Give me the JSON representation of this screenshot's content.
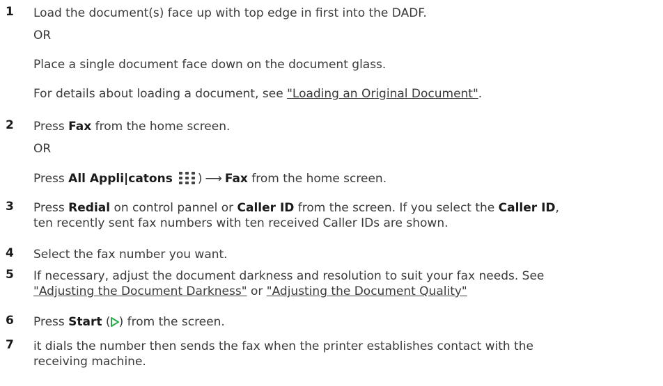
{
  "steps": [
    {
      "number": "1",
      "text": "Load the document(s) face up with top edge in first into the DADF.",
      "or1": "OR",
      "alt": "Place a single document face down on the document glass.",
      "details_prefix": "For details about loading a document, see ",
      "details_link": "\"Loading an Original Document\"",
      "details_suffix": "."
    },
    {
      "number": "2",
      "press": "Press ",
      "fax": "Fax",
      "from_home": " from the home screen.",
      "or": "OR",
      "press2": "Press ",
      "all_apps": "All Appli|catons",
      "close_paren": ")",
      "arrow": "⟶",
      "fax2": "Fax",
      "from_home2": " from the home screen."
    },
    {
      "number": "3",
      "press": "Press ",
      "redial": "Redial",
      "mid": " on control pannel or ",
      "caller_id": "Caller ID",
      "mid2": " from the screen. If you select the ",
      "caller_id2": "Caller ID",
      "end": ",",
      "line2": "ten recently sent fax numbers with ten received Caller IDs are shown."
    },
    {
      "number": "4",
      "text": "Select the fax number you want."
    },
    {
      "number": "5",
      "text": "If necessary, adjust the document darkness and resolution to suit your fax needs. See",
      "link1": "\"Adjusting the Document Darkness\"",
      "or": " or ",
      "link2": "\"Adjusting the Document Quality\""
    },
    {
      "number": "6",
      "press": "Press ",
      "start": "Start",
      "open": " (",
      "close": ") from the screen."
    },
    {
      "number": "7",
      "text": "it dials the number then sends the fax when the printer establishes contact with the",
      "line2": "receiving machine."
    }
  ],
  "colors": {
    "text": "#3a3a3a",
    "start_icon": "#2aa84a",
    "apps_icon": "#444444"
  },
  "icons": {
    "apps": "grid-dots-icon",
    "start": "play-triangle-icon"
  }
}
